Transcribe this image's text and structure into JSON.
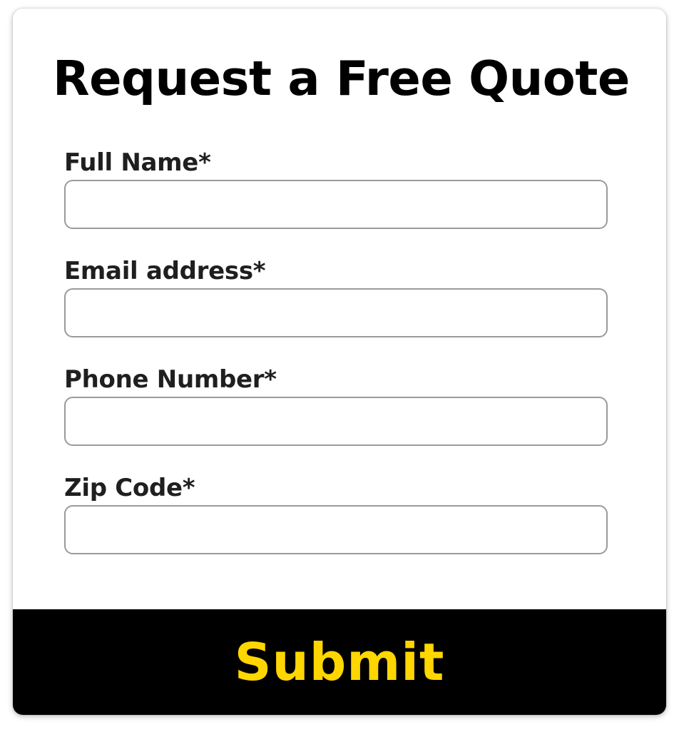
{
  "form": {
    "title": "Request a Free Quote",
    "fields": [
      {
        "label": "Full Name*",
        "value": "",
        "placeholder": ""
      },
      {
        "label": "Email address*",
        "value": "",
        "placeholder": ""
      },
      {
        "label": "Phone Number*",
        "value": "",
        "placeholder": ""
      },
      {
        "label": "Zip Code*",
        "value": "",
        "placeholder": ""
      }
    ],
    "submit_label": "Submit"
  },
  "colors": {
    "button_background": "#000000",
    "button_text": "#ffd600",
    "input_border": "#9a9a9a",
    "label_text": "#1f1f1f"
  }
}
